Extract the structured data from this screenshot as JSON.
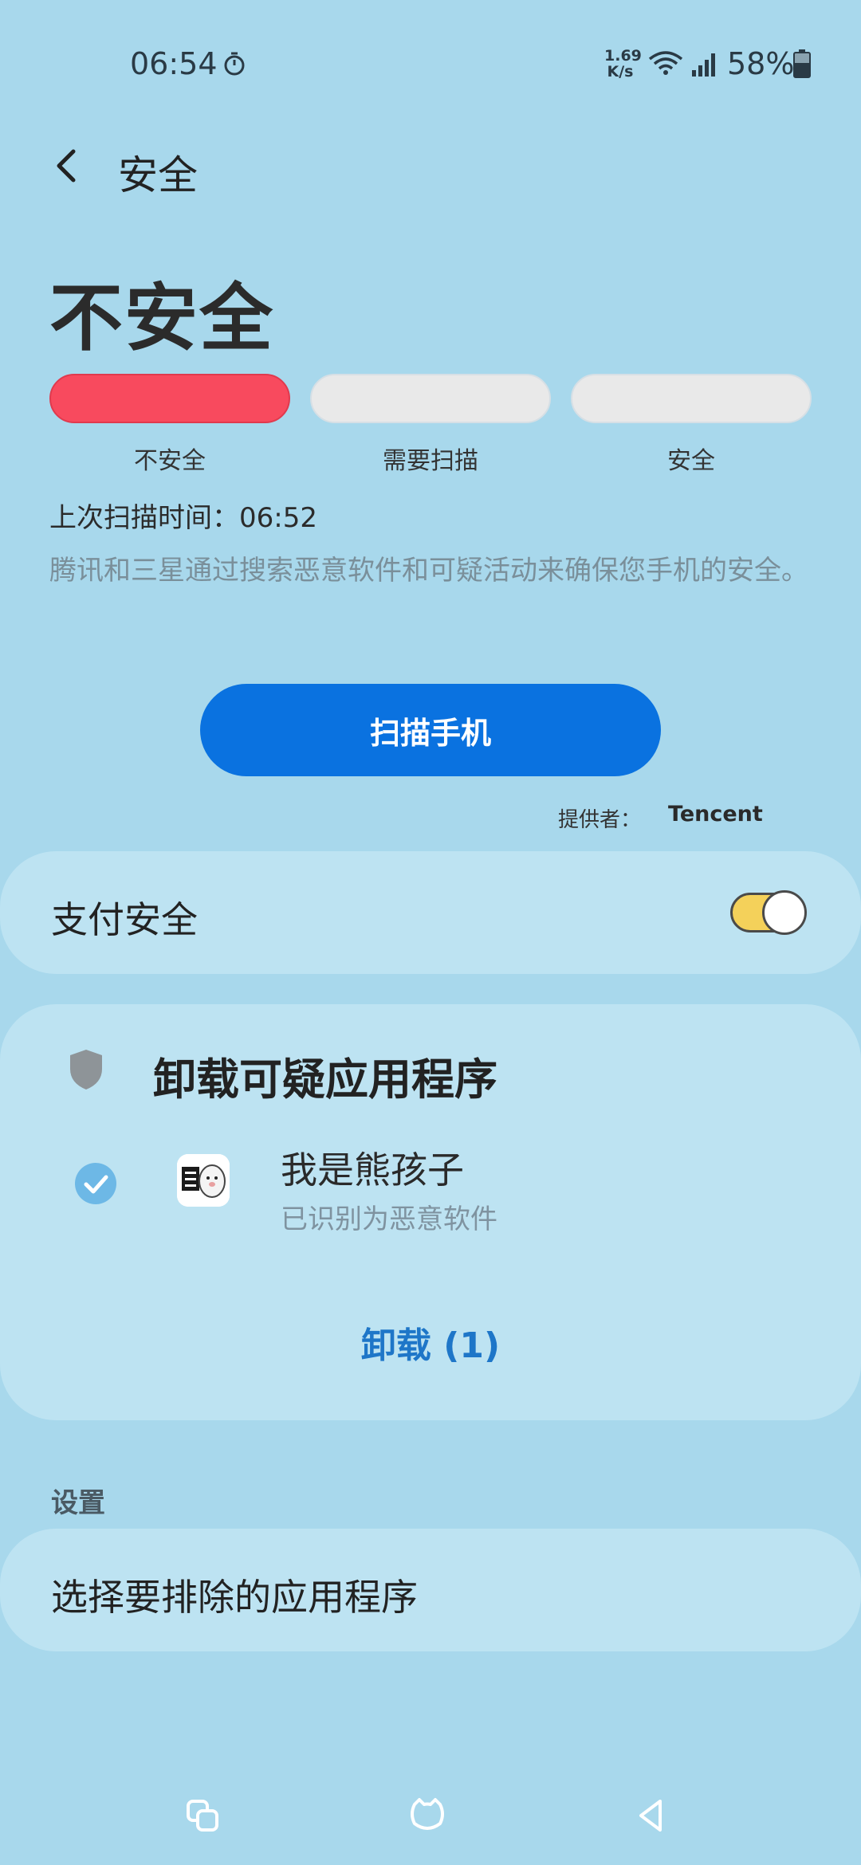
{
  "status_bar": {
    "time": "06:54",
    "net_speed_value": "1.69",
    "net_speed_unit": "K/s",
    "battery": "58%",
    "icons": [
      "timer-icon",
      "wifi-icon",
      "signal-icon",
      "battery-icon"
    ]
  },
  "header": {
    "title": "安全",
    "back_icon": "chevron-left-icon"
  },
  "security_status": {
    "title": "不安全",
    "level": 1,
    "levels": [
      "不安全",
      "需要扫描",
      "安全"
    ],
    "colors": {
      "active": "#f84a5e",
      "inactive": "#e9e9e9"
    },
    "last_scan": "上次扫描时间：06:52",
    "description": "腾讯和三星通过搜索恶意软件和可疑活动来确保您手机的安全。",
    "scan_button": "扫描手机",
    "provider_label": "提供者：",
    "provider_name": "Tencent"
  },
  "payment_security": {
    "label": "支付安全",
    "enabled": true
  },
  "suspicious_apps": {
    "title": "卸载可疑应用程序",
    "apps": [
      {
        "name": "我是熊孩子",
        "status": "已识别为恶意软件",
        "checked": true
      }
    ],
    "uninstall_button": "卸载 (1)"
  },
  "settings": {
    "header": "设置",
    "exclude_apps": "选择要排除的应用程序"
  },
  "nav_bar": {
    "icons": [
      "recent-apps-icon",
      "home-icon",
      "back-icon"
    ]
  }
}
